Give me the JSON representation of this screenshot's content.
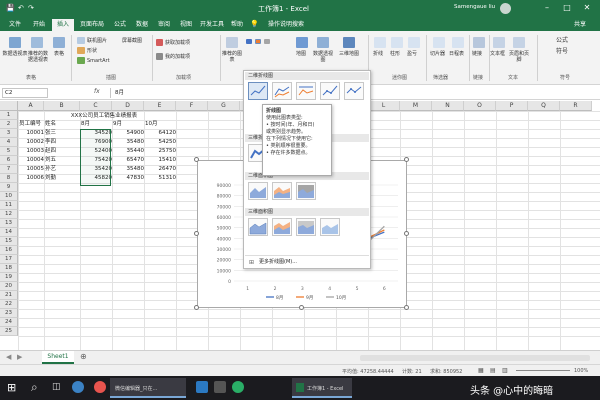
{
  "titlebar": {
    "doc_title": "工作簿1 - Excel",
    "user_name": "Samengaue liu",
    "quick_save": "💾",
    "quick_undo": "↶",
    "quick_redo": "↷"
  },
  "tabs": [
    "文件",
    "开始",
    "插入",
    "页面布局",
    "公式",
    "数据",
    "审阅",
    "视图",
    "开发工具",
    "帮助",
    "操作说明搜索"
  ],
  "active_tab": "插入",
  "share_label": "共享",
  "ribbon": {
    "groups": [
      "表格",
      "插图",
      "加载项",
      "图表",
      "迷你图",
      "筛选器",
      "链接",
      "文本",
      "符号"
    ],
    "buttons": {
      "pivot": "数据透视表",
      "recommended_pivot": "推荐的数据透视表",
      "table": "表格",
      "pictures": "联机图片",
      "shapes": "形状",
      "smartart": "SmartArt",
      "screenshot": "屏幕截图",
      "get_addins": "获取加载项",
      "my_addins": "我的加载项",
      "recommended_charts": "推荐的图表",
      "map": "地图",
      "pivot_chart": "数据透视图",
      "3d_map": "三维地图",
      "line": "折线",
      "column": "柱形",
      "winloss": "盈亏",
      "slicer": "切片器",
      "timeline": "日程表",
      "link": "链接",
      "textbox": "文本框",
      "header_footer": "页眉和页脚",
      "equation": "公式",
      "symbol": "符号"
    }
  },
  "formula_bar": {
    "name_box": "C2",
    "fx": "fx",
    "value": "8月"
  },
  "columns": [
    "A",
    "B",
    "C",
    "D",
    "E",
    "F",
    "G",
    "H",
    "I",
    "J",
    "K",
    "L",
    "M",
    "N",
    "O",
    "P",
    "Q",
    "R"
  ],
  "rows": [
    "1",
    "2",
    "3",
    "4",
    "5",
    "6",
    "7",
    "8",
    "9",
    "10",
    "11",
    "12",
    "13",
    "14",
    "15",
    "16",
    "17",
    "18",
    "19",
    "20",
    "21",
    "22",
    "23",
    "24",
    "25"
  ],
  "sheet": {
    "title": "XXX公司员工销售业绩报表",
    "headers": [
      "员工编号",
      "姓名",
      "8月",
      "9月",
      "10月"
    ],
    "data": [
      [
        "10001",
        "张三",
        "34520",
        "54900",
        "64120"
      ],
      [
        "10002",
        "李四",
        "76900",
        "35480",
        "54250"
      ],
      [
        "10003",
        "赵四",
        "52400",
        "35440",
        "25750"
      ],
      [
        "10004",
        "刘五",
        "75420",
        "65470",
        "15410"
      ],
      [
        "10005",
        "孙艺",
        "35420",
        "35480",
        "26470"
      ],
      [
        "10006",
        "刘勤",
        "45820",
        "47830",
        "51310"
      ]
    ]
  },
  "gallery": {
    "sections": [
      "二维折线图",
      "三维折线图",
      "二维面积图",
      "三维面积图"
    ],
    "more_label": "更多折线图(M)..."
  },
  "tooltip": {
    "title": "折线图",
    "lines": [
      "使用此图表类型:",
      "• 按时间(年、月和日)",
      "或类别显示趋势。",
      "",
      "在下列情况下使用它:",
      "• 类别顺序很重要。",
      "• 存在许多数据点。"
    ]
  },
  "chart_data": {
    "type": "line",
    "categories": [
      "1",
      "2",
      "3",
      "4",
      "5",
      "6"
    ],
    "ylim": [
      0,
      90000
    ],
    "yticks": [
      "0",
      "10000",
      "20000",
      "30000",
      "40000",
      "50000",
      "60000",
      "70000",
      "80000",
      "90000"
    ],
    "series": [
      {
        "name": "8月",
        "values": [
          34520,
          76900,
          52400,
          75420,
          35420,
          45820
        ],
        "color": "#4472c4"
      },
      {
        "name": "9月",
        "values": [
          54900,
          35480,
          35440,
          65470,
          35480,
          47830
        ],
        "color": "#ed7d31"
      },
      {
        "name": "10月",
        "values": [
          64120,
          54250,
          25750,
          15410,
          26470,
          51310
        ],
        "color": "#a5a5a5"
      }
    ]
  },
  "sheet_tabs": [
    "Sheet1"
  ],
  "status": {
    "average": "平均值: 47258.44444",
    "count": "计数: 21",
    "sum": "求和: 850952",
    "zoom": "100%"
  },
  "taskbar": {
    "search_icon": "⌕",
    "apps": [
      "微信编辑器_只在...",
      "工作簿1 - Excel"
    ],
    "time": "",
    "watermark": "头条 @心中的晦暗"
  },
  "colors": {
    "excel_green": "#217346"
  }
}
